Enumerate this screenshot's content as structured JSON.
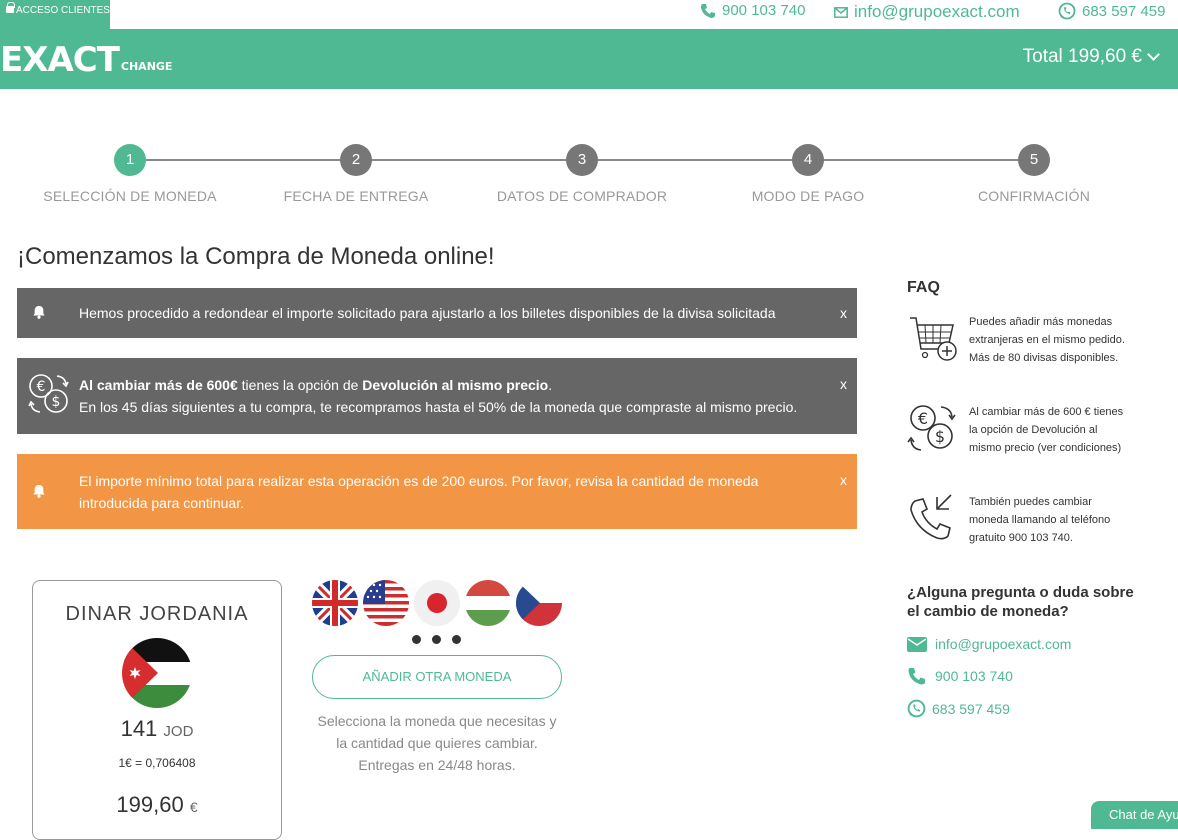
{
  "topbar": {
    "acceso_label": "ACCESO CLIENTES",
    "phone1": "900 103 740",
    "email": "info@grupoexact.com",
    "phone2": "683 597 459"
  },
  "navbar": {
    "logo_main": "EXACT",
    "logo_sub": "CHANGE",
    "total_label": "Total 199,60 €"
  },
  "steps": [
    {
      "num": "1",
      "label": "SELECCIÓN DE MONEDA",
      "active": true
    },
    {
      "num": "2",
      "label": "FECHA DE ENTREGA",
      "active": false
    },
    {
      "num": "3",
      "label": "DATOS DE COMPRADOR",
      "active": false
    },
    {
      "num": "4",
      "label": "MODO DE PAGO",
      "active": false
    },
    {
      "num": "5",
      "label": "CONFIRMACIÓN",
      "active": false
    }
  ],
  "main_title": "¡Comenzamos la Compra de Moneda online!",
  "alerts": {
    "rounding": {
      "text": "Hemos procedido a redondear el importe solicitado para ajustarlo a los billetes disponibles de la divisa solicitada",
      "close": "x"
    },
    "refund": {
      "bold1": "Al cambiar más de 600€",
      "text1": " tienes la opción de ",
      "bold2": "Devolución al mismo precio",
      "text2": ".",
      "line2": "En los 45 días siguientes a tu compra, te recompramos hasta el 50% de la moneda que compraste al mismo precio.",
      "close": "x"
    },
    "minimum": {
      "text": "El importe mínimo total para realizar esta operación es de 200 euros. Por favor, revisa la cantidad de moneda introducida para continuar.",
      "close": "x"
    }
  },
  "currency_card": {
    "name": "DINAR JORDANIA",
    "amount": "141",
    "code": "JOD",
    "rate": "1€ = 0,706408",
    "eur_amount": "199,60",
    "eur_symbol": "€"
  },
  "add_button_label": "AÑADIR OTRA MONEDA",
  "help_text": "Selecciona la moneda que necesitas y la cantidad que quieres cambiar. Entregas en 24/48 horas.",
  "faq": {
    "title": "FAQ",
    "items": [
      {
        "icon": "cart-plus-icon",
        "text": "Puedes añadir más monedas extranjeras en el mismo pedido. Más de 80 divisas disponibles."
      },
      {
        "icon": "currency-exchange-icon",
        "text": "Al cambiar más de 600 € tienes la opción de Devolución al mismo precio (ver condiciones)"
      },
      {
        "icon": "phone-callback-icon",
        "text": "También puedes cambiar moneda llamando al teléfono gratuito 900 103 740."
      }
    ]
  },
  "question": "¿Alguna pregunta o duda sobre el cambio de moneda?",
  "side_contacts": {
    "email": "info@grupoexact.com",
    "phone": "900 103 740",
    "whatsapp": "683 597 459"
  },
  "chat_label": "Chat de Ayuda",
  "colors": {
    "brand": "#4fb994",
    "alert_gray": "#666666",
    "alert_orange": "#f29645"
  }
}
